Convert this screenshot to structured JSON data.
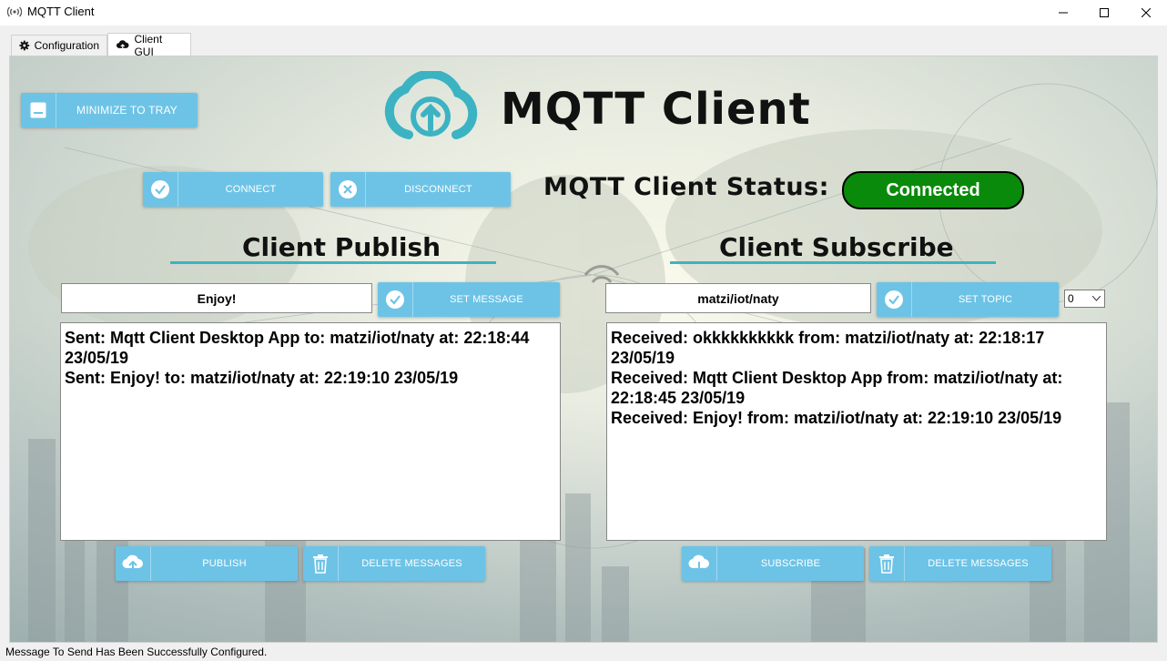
{
  "window": {
    "title": "MQTT Client"
  },
  "tabs": [
    {
      "label": "Configuration",
      "icon": "gear-icon"
    },
    {
      "label": "Client GUI",
      "icon": "cloud-icon"
    }
  ],
  "header": {
    "logo_text": "MQTT Client",
    "minimize_label": "MINIMIZE TO TRAY"
  },
  "connection": {
    "connect_label": "CONNECT",
    "disconnect_label": "DISCONNECT",
    "status_label": "MQTT Client Status:",
    "status_value": "Connected",
    "status_color": "#0a8a0a"
  },
  "publish": {
    "title": "Client Publish",
    "message_value": "Enjoy!",
    "set_message_label": "SET MESSAGE",
    "messages": [
      "Sent:  Mqtt Client Desktop App  to: matzi/iot/naty at: 22:18:44 23/05/19",
      "Sent:  Enjoy!  to: matzi/iot/naty at: 22:19:10 23/05/19"
    ],
    "publish_label": "PUBLISH",
    "delete_label": "DELETE MESSAGES"
  },
  "subscribe": {
    "title": "Client Subscribe",
    "topic_value": "matzi/iot/naty",
    "set_topic_label": "SET TOPIC",
    "qos_value": "0",
    "messages": [
      "Received: okkkkkkkkkk from: matzi/iot/naty at: 22:18:17 23/05/19",
      "Received: Mqtt Client Desktop App from: matzi/iot/naty at: 22:18:45 23/05/19",
      "Received: Enjoy! from: matzi/iot/naty at: 22:19:10 23/05/19"
    ],
    "subscribe_label": "SUBSCRIBE",
    "delete_label": "DELETE MESSAGES"
  },
  "colors": {
    "accent": "#6dc3e6",
    "teal": "#3bb3c3"
  },
  "statusbar": {
    "text": "Message To Send Has Been Successfully Configured."
  }
}
